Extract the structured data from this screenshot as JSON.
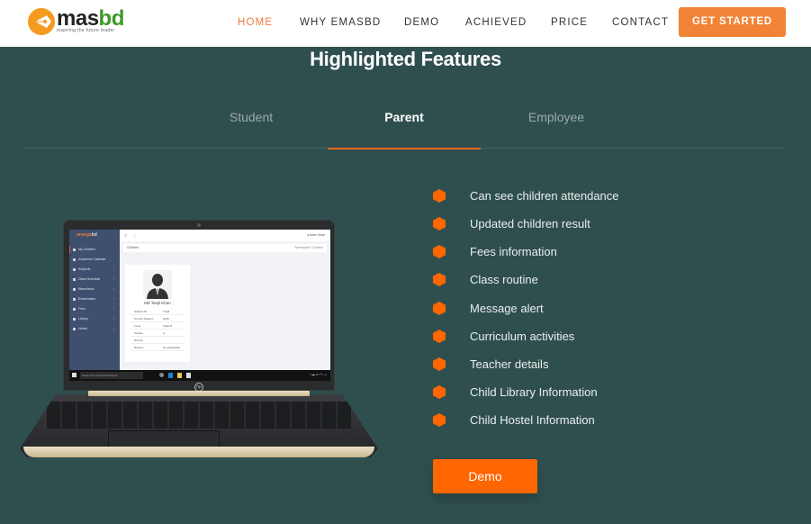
{
  "brand": {
    "name_part1": "mas",
    "name_part2": "bd",
    "tagline": "inspiring the future leader",
    "accent": "#f08335",
    "logo_icon": "pen-nib-circle-icon"
  },
  "nav": {
    "links": [
      {
        "label": "HOME",
        "active": true
      },
      {
        "label": "WHY EMASBD",
        "active": false
      },
      {
        "label": "DEMO",
        "active": false
      },
      {
        "label": "ACHIEVED",
        "active": false
      },
      {
        "label": "PRICE",
        "active": false
      },
      {
        "label": "CONTACT",
        "active": false
      }
    ],
    "cta_label": "GET STARTED"
  },
  "section": {
    "title": "Highlighted Features",
    "background": "#2f4f4e",
    "tabs": [
      {
        "label": "Student",
        "active": false
      },
      {
        "label": "Parent",
        "active": true
      },
      {
        "label": "Employee",
        "active": false
      }
    ],
    "features": [
      "Can see children attendance",
      "Updated children result",
      "Fees information",
      "Class routine",
      "Message alert",
      "Curriculum activities",
      "Teacher details",
      "Child Library Information",
      "Child Hostel Information"
    ],
    "bullet_icon": "hexagon-icon",
    "bullet_color": "#ff6600",
    "demo_button": "Demo"
  },
  "laptop_screen": {
    "app_logo_part1": "orange",
    "app_logo_part2": "bd",
    "sidebar": [
      {
        "label": "My Children",
        "arrow": false
      },
      {
        "label": "Academic Calendar",
        "arrow": false
      },
      {
        "label": "Subjects",
        "arrow": true
      },
      {
        "label": "Class Schedule",
        "arrow": true
      },
      {
        "label": "Attendance",
        "arrow": true
      },
      {
        "label": "Examination",
        "arrow": true
      },
      {
        "label": "Fees",
        "arrow": true
      },
      {
        "label": "Library",
        "arrow": true
      },
      {
        "label": "Hostel",
        "arrow": true
      }
    ],
    "user_name": "Alam Khan",
    "page_label": "Children",
    "breadcrumb": "Parentpanel / Children",
    "card": {
      "name": "Md Tanjil Khan",
      "rows": [
        {
          "key": "Student ID",
          "value": "Tnajil"
        },
        {
          "key": "Current Session",
          "value": "2020"
        },
        {
          "key": "Level",
          "value": "Class 8"
        },
        {
          "key": "Section",
          "value": "A"
        },
        {
          "key": "Roll No",
          "value": ""
        },
        {
          "key": "Division",
          "value": "Not Applicable"
        }
      ]
    },
    "taskbar_search": "Search the web and Windows",
    "brand_mark": "hp"
  }
}
